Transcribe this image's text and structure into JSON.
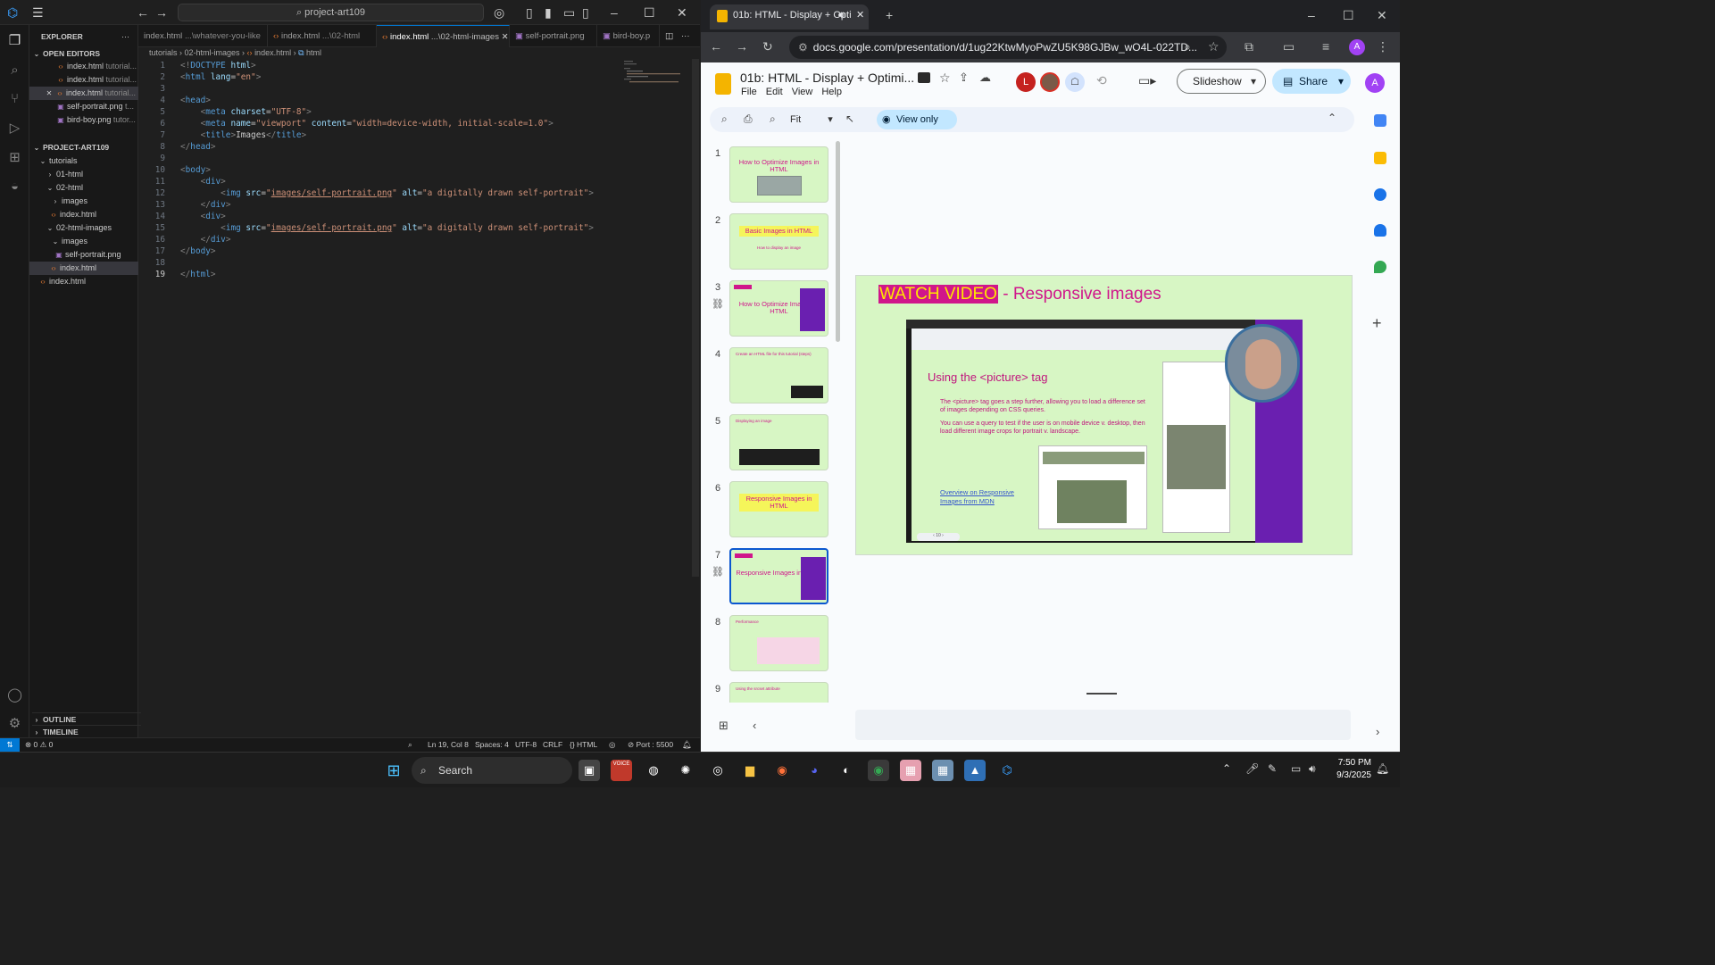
{
  "vscode": {
    "search_text": "project-art109",
    "explorer_title": "EXPLORER",
    "open_editors_label": "OPEN EDITORS",
    "open_editors": [
      {
        "name": "index.html",
        "hint": "tutorial..."
      },
      {
        "name": "index.html",
        "hint": "tutorial..."
      },
      {
        "name": "index.html",
        "hint": "tutorial..."
      },
      {
        "name": "self-portrait.png",
        "hint": "t..."
      },
      {
        "name": "bird-boy.png",
        "hint": "tutor..."
      }
    ],
    "project_label": "PROJECT-ART109",
    "tree": [
      {
        "name": "tutorials"
      },
      {
        "name": "01-html"
      },
      {
        "name": "02-html"
      },
      {
        "name": "images"
      },
      {
        "name": "index.html"
      },
      {
        "name": "02-html-images"
      },
      {
        "name": "images"
      },
      {
        "name": "self-portrait.png"
      },
      {
        "name": "index.html"
      },
      {
        "name": "index.html"
      }
    ],
    "outline_label": "OUTLINE",
    "timeline_label": "TIMELINE",
    "tabs": [
      {
        "name": "index.html",
        "hint": "...\\whatever-you-like"
      },
      {
        "name": "index.html",
        "hint": "...\\02-html"
      },
      {
        "name": "index.html",
        "hint": "...\\02-html-images"
      },
      {
        "name": "self-portrait.png",
        "hint": ""
      },
      {
        "name": "bird-boy.p",
        "hint": ""
      }
    ],
    "breadcrumb": [
      "tutorials",
      "02-html-images",
      "index.html",
      "html"
    ],
    "code": [
      {
        "n": "1",
        "parts": [
          [
            "tg",
            "<!"
          ],
          [
            "tn",
            "DOCTYPE"
          ],
          [
            "at",
            " html"
          ],
          [
            "tg",
            ">"
          ]
        ]
      },
      {
        "n": "2",
        "parts": [
          [
            "tg",
            "<"
          ],
          [
            "tn",
            "html"
          ],
          [
            "at",
            " lang"
          ],
          [
            "",
            "="
          ],
          [
            "st",
            "\"en\""
          ],
          [
            "tg",
            ">"
          ]
        ]
      },
      {
        "n": "3",
        "parts": []
      },
      {
        "n": "4",
        "parts": [
          [
            "tg",
            "<"
          ],
          [
            "tn",
            "head"
          ],
          [
            "tg",
            ">"
          ]
        ]
      },
      {
        "n": "5",
        "parts": [
          [
            "",
            "    "
          ],
          [
            "tg",
            "<"
          ],
          [
            "tn",
            "meta"
          ],
          [
            "at",
            " charset"
          ],
          [
            "",
            "="
          ],
          [
            "st",
            "\"UTF-8\""
          ],
          [
            "tg",
            ">"
          ]
        ]
      },
      {
        "n": "6",
        "parts": [
          [
            "",
            "    "
          ],
          [
            "tg",
            "<"
          ],
          [
            "tn",
            "meta"
          ],
          [
            "at",
            " name"
          ],
          [
            "",
            "="
          ],
          [
            "st",
            "\"viewport\""
          ],
          [
            "at",
            " content"
          ],
          [
            "",
            "="
          ],
          [
            "st",
            "\"width=device-width, initial-scale=1.0\""
          ],
          [
            "tg",
            ">"
          ]
        ]
      },
      {
        "n": "7",
        "parts": [
          [
            "",
            "    "
          ],
          [
            "tg",
            "<"
          ],
          [
            "tn",
            "title"
          ],
          [
            "tg",
            ">"
          ],
          [
            "",
            "Images"
          ],
          [
            "tg",
            "</"
          ],
          [
            "tn",
            "title"
          ],
          [
            "tg",
            ">"
          ]
        ]
      },
      {
        "n": "8",
        "parts": [
          [
            "tg",
            "</"
          ],
          [
            "tn",
            "head"
          ],
          [
            "tg",
            ">"
          ]
        ]
      },
      {
        "n": "9",
        "parts": []
      },
      {
        "n": "10",
        "parts": [
          [
            "tg",
            "<"
          ],
          [
            "tn",
            "body"
          ],
          [
            "tg",
            ">"
          ]
        ]
      },
      {
        "n": "11",
        "parts": [
          [
            "",
            "    "
          ],
          [
            "tg",
            "<"
          ],
          [
            "tn",
            "div"
          ],
          [
            "tg",
            ">"
          ]
        ]
      },
      {
        "n": "12",
        "parts": [
          [
            "",
            "        "
          ],
          [
            "tg",
            "<"
          ],
          [
            "tn",
            "img"
          ],
          [
            "at",
            " src"
          ],
          [
            "",
            "="
          ],
          [
            "st",
            "\""
          ],
          [
            "su",
            "images/self-portrait.png"
          ],
          [
            "st",
            "\""
          ],
          [
            "at",
            " alt"
          ],
          [
            "",
            "="
          ],
          [
            "st",
            "\"a digitally drawn self-portrait\""
          ],
          [
            "tg",
            ">"
          ]
        ]
      },
      {
        "n": "13",
        "parts": [
          [
            "",
            "    "
          ],
          [
            "tg",
            "</"
          ],
          [
            "tn",
            "div"
          ],
          [
            "tg",
            ">"
          ]
        ]
      },
      {
        "n": "14",
        "parts": [
          [
            "",
            "    "
          ],
          [
            "tg",
            "<"
          ],
          [
            "tn",
            "div"
          ],
          [
            "tg",
            ">"
          ]
        ]
      },
      {
        "n": "15",
        "parts": [
          [
            "",
            "        "
          ],
          [
            "tg",
            "<"
          ],
          [
            "tn",
            "img"
          ],
          [
            "at",
            " src"
          ],
          [
            "",
            "="
          ],
          [
            "st",
            "\""
          ],
          [
            "su",
            "images/self-portrait.png"
          ],
          [
            "st",
            "\""
          ],
          [
            "at",
            " alt"
          ],
          [
            "",
            "="
          ],
          [
            "st",
            "\"a digitally drawn self-portrait\""
          ],
          [
            "tg",
            ">"
          ]
        ]
      },
      {
        "n": "16",
        "parts": [
          [
            "",
            "    "
          ],
          [
            "tg",
            "</"
          ],
          [
            "tn",
            "div"
          ],
          [
            "tg",
            ">"
          ]
        ]
      },
      {
        "n": "17",
        "parts": [
          [
            "tg",
            "</"
          ],
          [
            "tn",
            "body"
          ],
          [
            "tg",
            ">"
          ]
        ]
      },
      {
        "n": "18",
        "parts": []
      },
      {
        "n": "19",
        "parts": [
          [
            "tg",
            "</"
          ],
          [
            "tn",
            "html"
          ],
          [
            "tg",
            ">"
          ]
        ]
      }
    ],
    "status": {
      "errors": "0",
      "warnings": "0",
      "position": "Ln 19, Col 8",
      "spaces": "Spaces: 4",
      "encoding": "UTF-8",
      "eol": "CRLF",
      "language": "HTML",
      "port": "Port : 5500"
    }
  },
  "chrome": {
    "tab_title": "01b: HTML - Display + Opti",
    "url": "docs.google.com/presentation/d/1ug22KtwMyoPwZU5K98GJBw_wO4L-022TD...",
    "profile_letter": "A"
  },
  "slides": {
    "doc_title": "01b: HTML - Display + Optimi...",
    "menu": [
      "File",
      "Edit",
      "View",
      "Help"
    ],
    "zoom": "Fit",
    "view_only": "View only",
    "slideshow": "Slideshow",
    "share": "Share",
    "collab_initial": "L",
    "thumbnails": [
      {
        "num": "1",
        "title": "How to Optimize Images in HTML",
        "sub": ""
      },
      {
        "num": "2",
        "title": "Basic Images in HTML",
        "sub": "How to display an image"
      },
      {
        "num": "3",
        "title": "How to Optimize Images in HTML",
        "sub": ""
      },
      {
        "num": "4",
        "title": "Create an HTML file for this tutorial (steps)",
        "sub": ""
      },
      {
        "num": "5",
        "title": "Displaying an image",
        "sub": ""
      },
      {
        "num": "6",
        "title": "Responsive Images in HTML",
        "sub": ""
      },
      {
        "num": "7",
        "title": "Responsive Images in HTML",
        "sub": ""
      },
      {
        "num": "8",
        "title": "Performance",
        "sub": ""
      },
      {
        "num": "9",
        "title": "Using the srcset attribute",
        "sub": ""
      }
    ],
    "current": {
      "highlight": "WATCH VIDEO",
      "title": " -  Responsive images",
      "video_heading": "Using the <picture> tag",
      "video_p1": "The <picture> tag goes a step further, allowing you to load a difference set of images depending on CSS queries.",
      "video_p2": "You can use a query to test if the user is on mobile device v. desktop, then load different image crops for portrait v. landscape.",
      "video_link": "Overview on Responsive Images from MDN"
    }
  },
  "taskbar": {
    "search": "Search",
    "time": "7:50 PM",
    "date": "9/3/2025"
  },
  "colors": {
    "accent_blue": "#0078d4",
    "slide_bg": "#d7f6c4",
    "slide_magenta": "#d0168b",
    "video_purple": "#6a1fb0"
  }
}
